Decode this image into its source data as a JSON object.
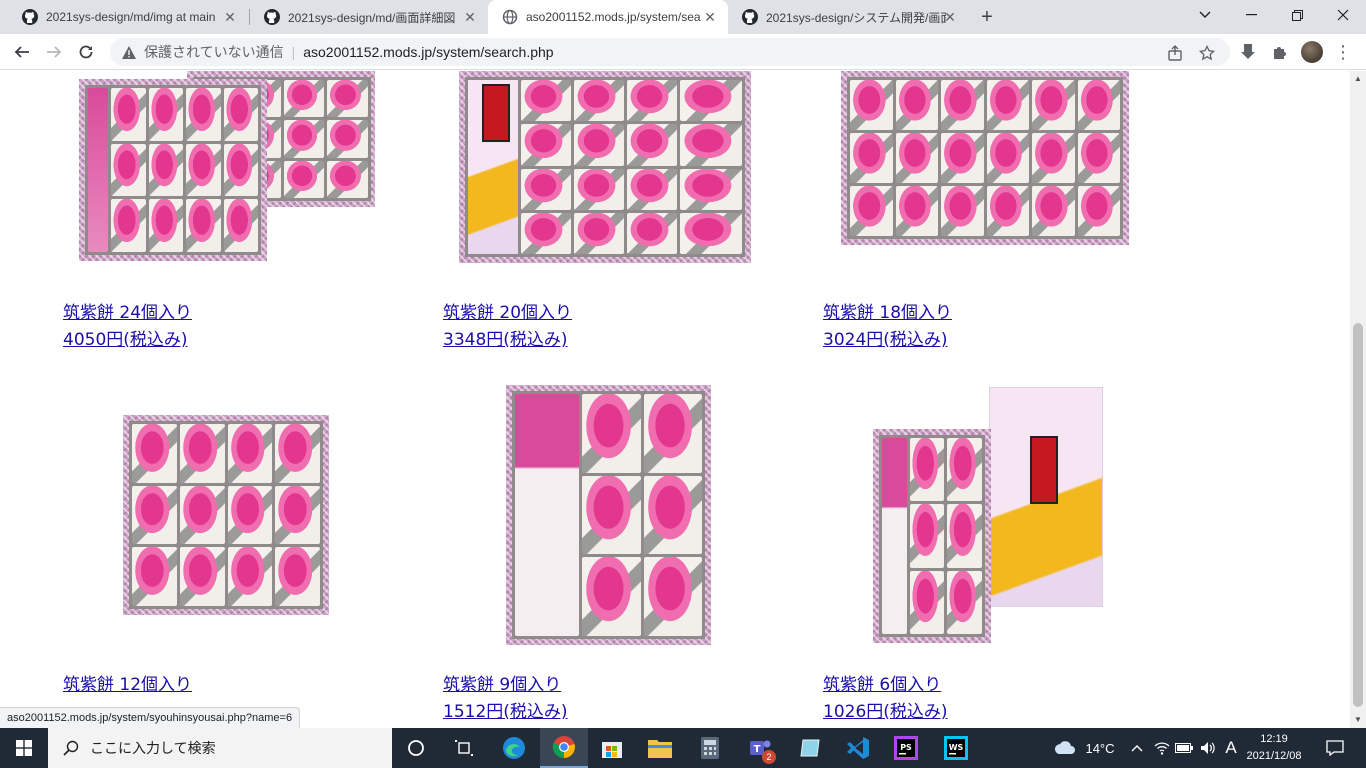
{
  "tabs": [
    {
      "title": "2021sys-design/md/img at main",
      "icon": "github-icon",
      "active": false
    },
    {
      "title": "2021sys-design/md/画面詳細図",
      "icon": "github-icon",
      "active": false
    },
    {
      "title": "aso2001152.mods.jp/system/sea",
      "icon": "globe-icon",
      "active": true
    },
    {
      "title": "2021sys-design/システム開発/画面",
      "icon": "github-icon",
      "active": false
    }
  ],
  "window": {
    "new_tab": "+"
  },
  "address": {
    "insecure_label": "保護されていない通信",
    "url": "aso2001152.mods.jp/system/search.php"
  },
  "products": [
    {
      "name": "筑紫餅 24個入り",
      "price": "4050円(税込み)",
      "pieces": 24
    },
    {
      "name": "筑紫餅 20個入り",
      "price": "3348円(税込み)",
      "pieces": 20
    },
    {
      "name": "筑紫餅 18個入り",
      "price": "3024円(税込み)",
      "pieces": 18
    },
    {
      "name": "筑紫餅 12個入り",
      "price": "",
      "pieces": 12
    },
    {
      "name": "筑紫餅 9個入り",
      "price": "1512円(税込み)",
      "pieces": 9
    },
    {
      "name": "筑紫餅 6個入り",
      "price": "1026円(税込み)",
      "pieces": 6
    }
  ],
  "status_bar": {
    "hover_url": "aso2001152.mods.jp/system/syouhinsyousai.php?name=6"
  },
  "taskbar": {
    "search_placeholder": "ここに入力して検索",
    "teams_badge": "2",
    "weather": "14°C",
    "ime": "A",
    "time": "12:19",
    "date": "2021/12/08"
  }
}
